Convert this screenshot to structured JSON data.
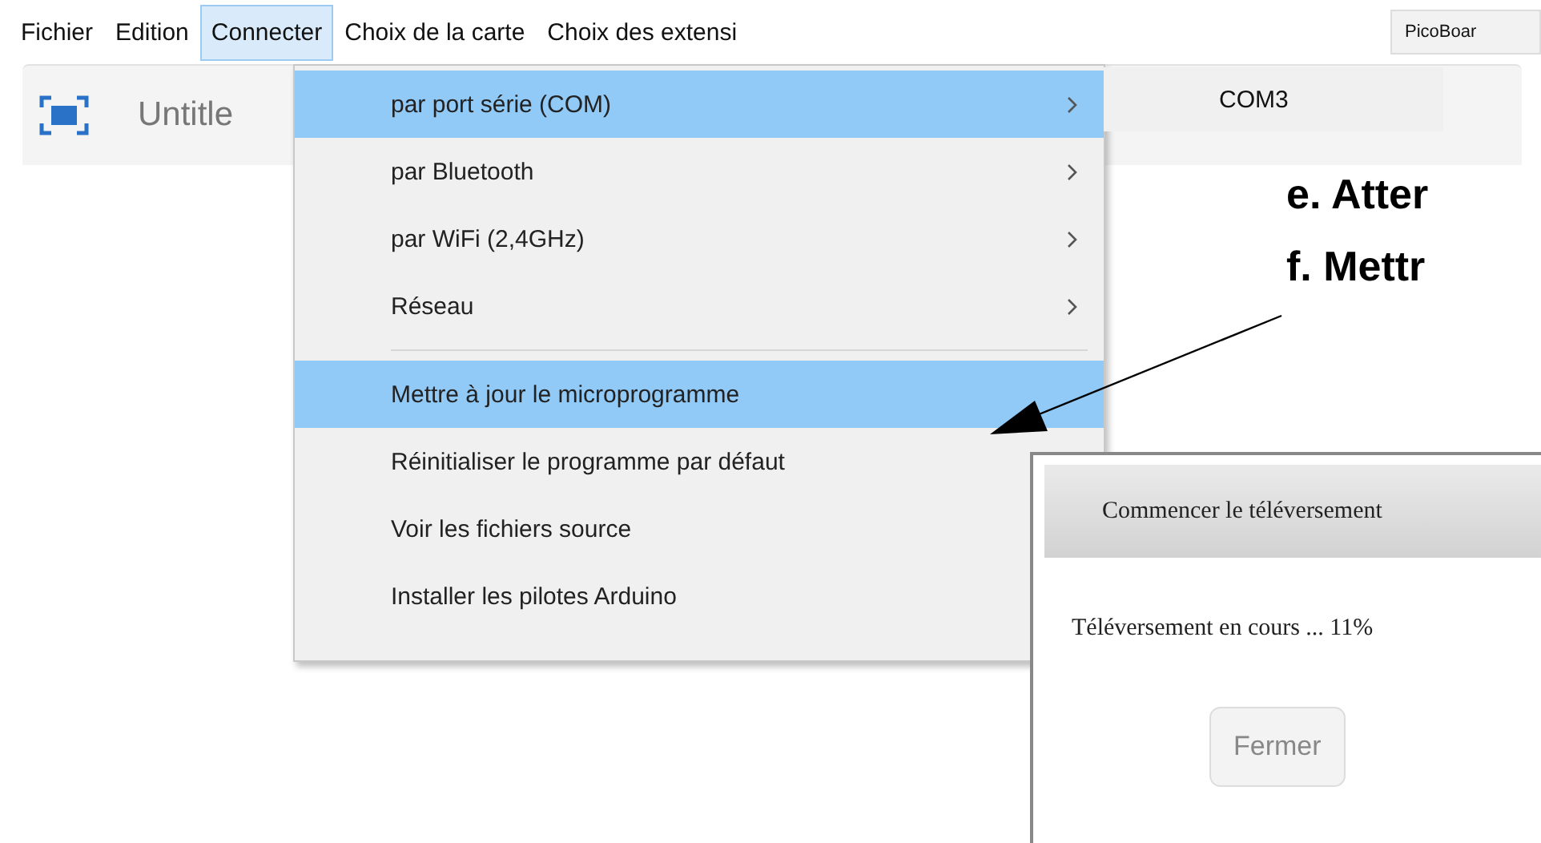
{
  "menu_bar": [
    {
      "label": "Fichier",
      "selected": false
    },
    {
      "label": "Edition",
      "selected": false
    },
    {
      "label": "Connecter",
      "selected": true
    },
    {
      "label": "Choix de la carte",
      "selected": false
    },
    {
      "label": "Choix des extensi",
      "selected": false
    }
  ],
  "board_label": "PicoBoar",
  "toolbar": {
    "title": "Untitle"
  },
  "menu": {
    "items": [
      {
        "kind": "submenu",
        "label": "par port série (COM)",
        "selected": true
      },
      {
        "kind": "submenu",
        "label": "par Bluetooth",
        "selected": false
      },
      {
        "kind": "submenu",
        "label": "par WiFi (2,4GHz)",
        "selected": false
      },
      {
        "kind": "submenu",
        "label": "Réseau",
        "selected": false
      },
      {
        "kind": "separator"
      },
      {
        "kind": "action",
        "label": "Mettre à jour le microprogramme",
        "selected": true
      },
      {
        "kind": "action",
        "label": "Réinitialiser le programme par défaut",
        "selected": false
      },
      {
        "kind": "action",
        "label": "Voir les fichiers source",
        "selected": false
      },
      {
        "kind": "action",
        "label": "Installer les pilotes Arduino",
        "selected": false
      }
    ],
    "submenu": [
      "COM3"
    ]
  },
  "annotations": [
    "e. Atter",
    "f. Mettr"
  ],
  "dialog": {
    "title": "Commencer le téléversement",
    "message": "Téléversement en cours ... 11%",
    "button": {
      "label": "Fermer",
      "disabled": true
    }
  }
}
